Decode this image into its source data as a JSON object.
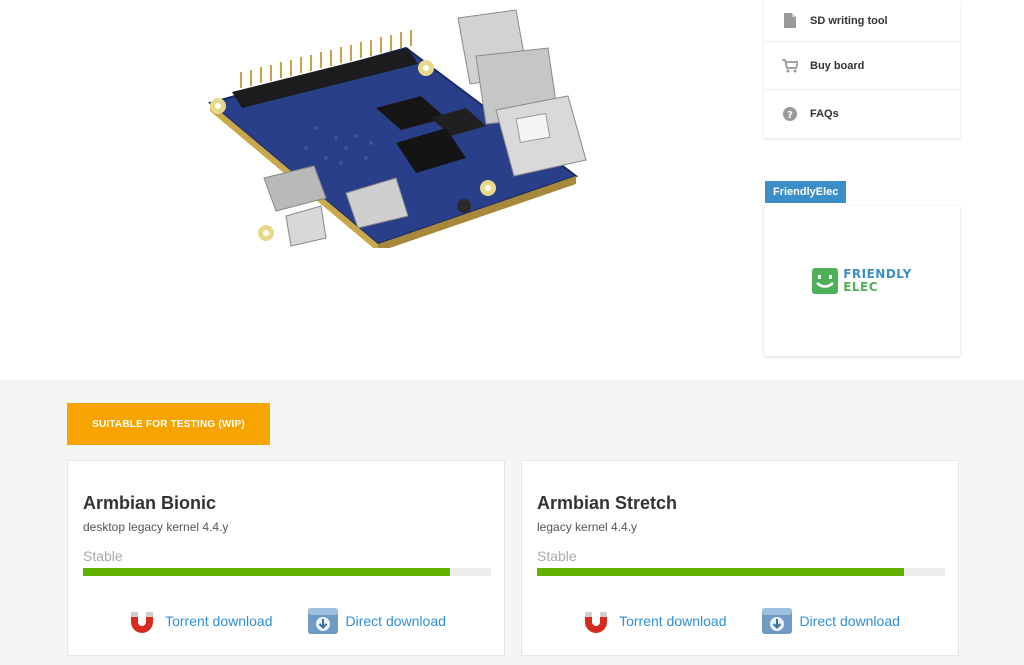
{
  "sidenav": {
    "items": [
      {
        "icon": "file-icon",
        "label": "SD writing tool"
      },
      {
        "icon": "cart-icon",
        "label": "Buy board"
      },
      {
        "icon": "question-icon",
        "label": "FAQs"
      }
    ]
  },
  "vendor": {
    "tag": "FriendlyElec",
    "logo_line1": "FRIENDLY",
    "logo_line2": "ELEC"
  },
  "status_badge": "SUITABLE FOR TESTING (WIP)",
  "builds": [
    {
      "title": "Armbian Bionic",
      "subtitle": "desktop legacy kernel 4.4.y",
      "stability": "Stable",
      "stability_level_percent": 90,
      "torrent_label": "Torrent download",
      "direct_label": "Direct download"
    },
    {
      "title": "Armbian Stretch",
      "subtitle": "legacy kernel 4.4.y",
      "stability": "Stable",
      "stability_level_percent": 90,
      "torrent_label": "Torrent download",
      "direct_label": "Direct download"
    }
  ],
  "colors": {
    "badge": "#f7a400",
    "progress": "#62b000",
    "link": "#2f8fd8",
    "vendor_tag": "#3b8fc9"
  }
}
